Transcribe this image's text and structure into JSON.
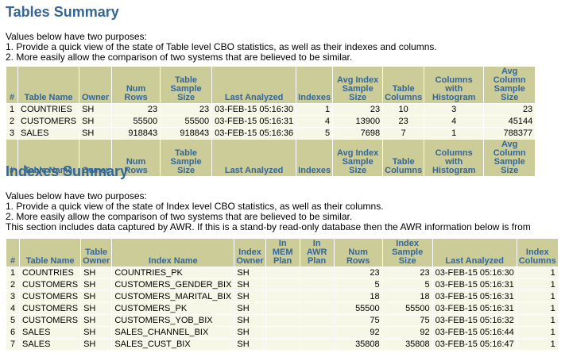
{
  "tables_summary": {
    "title": "Tables Summary",
    "intro": [
      "Values below have two purposes:",
      "1. Provide a quick view of the state of Table level CBO statistics, as well as their indexes and columns.",
      "2. More easily allow the comparison of two systems that are believed to be similar."
    ],
    "headers": [
      "#",
      "Table Name",
      "Owner",
      "Num Rows",
      "Table Sample Size",
      "Last Analyzed",
      "Indexes",
      "Avg Index Sample Size",
      "Table Columns",
      "Columns with Histogram",
      "Avg Column Sample Size"
    ],
    "rows": [
      [
        "1",
        "COUNTRIES",
        "SH",
        "23",
        "23",
        "03-FEB-15 05:16:30",
        "1",
        "23",
        "10",
        "3",
        "23"
      ],
      [
        "2",
        "CUSTOMERS",
        "SH",
        "55500",
        "55500",
        "03-FEB-15 05:16:31",
        "4",
        "13900",
        "23",
        "4",
        "45144"
      ],
      [
        "3",
        "SALES",
        "SH",
        "918843",
        "918843",
        "03-FEB-15 05:16:36",
        "5",
        "7698",
        "7",
        "1",
        "788377"
      ]
    ]
  },
  "indexes_summary": {
    "title": "Indexes Summary",
    "intro": [
      "Values below have two purposes:",
      "1. Provide a quick view of the state of Index level CBO statistics, as well as their columns.",
      "2. More easily allow the comparison of two systems that are believed to be similar.",
      "This section includes data captured by AWR. If this is a stand-by read-only database then the AWR information below is from"
    ],
    "headers": [
      "#",
      "Table Name",
      "Table Owner",
      "Index Name",
      "Index Owner",
      "In MEM Plan",
      "In AWR Plan",
      "Num Rows",
      "Index Sample Size",
      "Last Analyzed",
      "Index Columns"
    ],
    "rows": [
      [
        "1",
        "COUNTRIES",
        "SH",
        "COUNTRIES_PK",
        "SH",
        "",
        "",
        "23",
        "23",
        "03-FEB-15 05:16:30",
        "1"
      ],
      [
        "2",
        "CUSTOMERS",
        "SH",
        "CUSTOMERS_GENDER_BIX",
        "SH",
        "",
        "",
        "5",
        "5",
        "03-FEB-15 05:16:31",
        "1"
      ],
      [
        "3",
        "CUSTOMERS",
        "SH",
        "CUSTOMERS_MARITAL_BIX",
        "SH",
        "",
        "",
        "18",
        "18",
        "03-FEB-15 05:16:31",
        "1"
      ],
      [
        "4",
        "CUSTOMERS",
        "SH",
        "CUSTOMERS_PK",
        "SH",
        "",
        "",
        "55500",
        "55500",
        "03-FEB-15 05:16:31",
        "1"
      ],
      [
        "5",
        "CUSTOMERS",
        "SH",
        "CUSTOMERS_YOB_BIX",
        "SH",
        "",
        "",
        "75",
        "75",
        "03-FEB-15 05:16:32",
        "1"
      ],
      [
        "6",
        "SALES",
        "SH",
        "SALES_CHANNEL_BIX",
        "SH",
        "",
        "",
        "92",
        "92",
        "03-FEB-15 05:16:44",
        "1"
      ],
      [
        "7",
        "SALES",
        "SH",
        "SALES_CUST_BIX",
        "SH",
        "",
        "",
        "35808",
        "35808",
        "03-FEB-15 05:16:47",
        "1"
      ]
    ]
  },
  "colors": {
    "heading": "#336699",
    "header_bg": "#cccc99",
    "row_bg": "#f7f7e7"
  }
}
